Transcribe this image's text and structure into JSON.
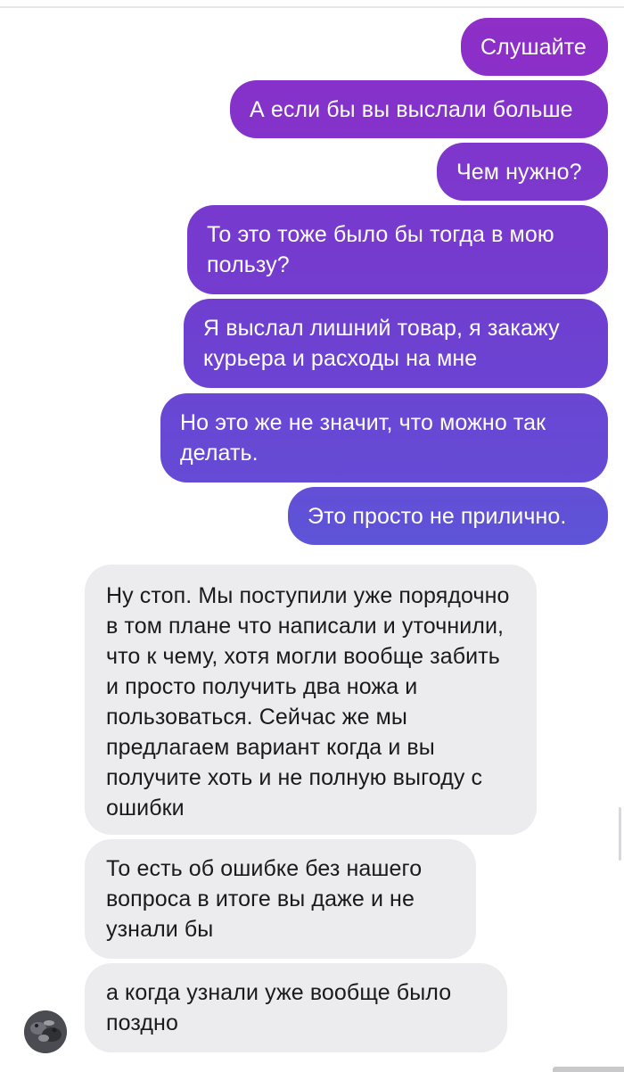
{
  "conversation": {
    "outgoing": [
      {
        "text": "Слушайте",
        "color_top": "#8e2fc7",
        "color_bottom": "#8a2fc8"
      },
      {
        "text": "А если бы вы выслали больше",
        "color_top": "#8631c9",
        "color_bottom": "#8333cb"
      },
      {
        "text": "Чем нужно?",
        "color_top": "#7f36cc",
        "color_bottom": "#7c38cd"
      },
      {
        "text": "То это тоже было бы тогда в мою пользу?",
        "color_top": "#7839ce",
        "color_bottom": "#733ccf"
      },
      {
        "text": "Я выслал лишний товар, я закажу курьера и расходы на мне",
        "color_top": "#703fd0",
        "color_bottom": "#6b43d2"
      },
      {
        "text": "Но это же не значит, что можно так делать.",
        "color_top": "#6946d3",
        "color_bottom": "#654bd5"
      },
      {
        "text": "Это просто не прилично.",
        "color_top": "#624fd6",
        "color_bottom": "#5e54d8"
      }
    ],
    "incoming": [
      {
        "text": "Ну стоп. Мы поступили уже порядочно в том плане что написали и уточнили, что к чему, хотя могли вообще забить и просто получить два ножа и пользоваться. Сейчас же мы предлагаем вариант когда и вы получите хоть и не полную выгоду с ошибки"
      },
      {
        "text": "То есть об ошибке без нашего вопроса в итоге вы даже и не узнали бы"
      },
      {
        "text": "а когда узнали уже вообще было поздно"
      }
    ]
  },
  "colors": {
    "incoming_bubble": "#ececee",
    "background": "#ffffff"
  },
  "icons": {
    "avatar": "contact-avatar-photo"
  }
}
